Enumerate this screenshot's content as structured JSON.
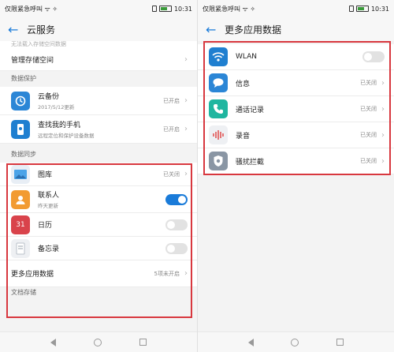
{
  "left": {
    "status_bar": {
      "carrier": "仅限紧急呼叫 ᯤ ✧",
      "time": "10:31"
    },
    "title": "云服务",
    "cut_text": "无法载入存储空间数据",
    "manage_storage": {
      "label": "管理存储空间"
    },
    "section_protection": "数据保护",
    "cloud_backup": {
      "label": "云备份",
      "sub": "2017/5/12更新",
      "status": "已开启"
    },
    "find_phone": {
      "label": "查找我的手机",
      "sub": "远程定位和保护设备数据",
      "status": "已开启"
    },
    "section_sync": "数据同步",
    "gallery": {
      "label": "图库",
      "status": "已关闭"
    },
    "contacts": {
      "label": "联系人",
      "sub": "昨天更新",
      "toggle": "on"
    },
    "calendar": {
      "label": "日历",
      "icon_text": "31",
      "toggle": "off"
    },
    "notes": {
      "label": "备忘录",
      "toggle": "off"
    },
    "more_apps": {
      "label": "更多应用数据",
      "status": "5项未开启"
    },
    "section_docs": "文档存储"
  },
  "right": {
    "status_bar": {
      "carrier": "仅限紧急呼叫 ᯤ ✧",
      "time": "10:31"
    },
    "title": "更多应用数据",
    "items": [
      {
        "label": "WLAN",
        "toggle": "off"
      },
      {
        "label": "信息",
        "status": "已关闭"
      },
      {
        "label": "通话记录",
        "status": "已关闭"
      },
      {
        "label": "录音",
        "status": "已关闭"
      },
      {
        "label": "骚扰拦截",
        "status": "已关闭"
      }
    ]
  },
  "colors": {
    "accent": "#1a7bd9",
    "highlight": "#d8373e"
  }
}
